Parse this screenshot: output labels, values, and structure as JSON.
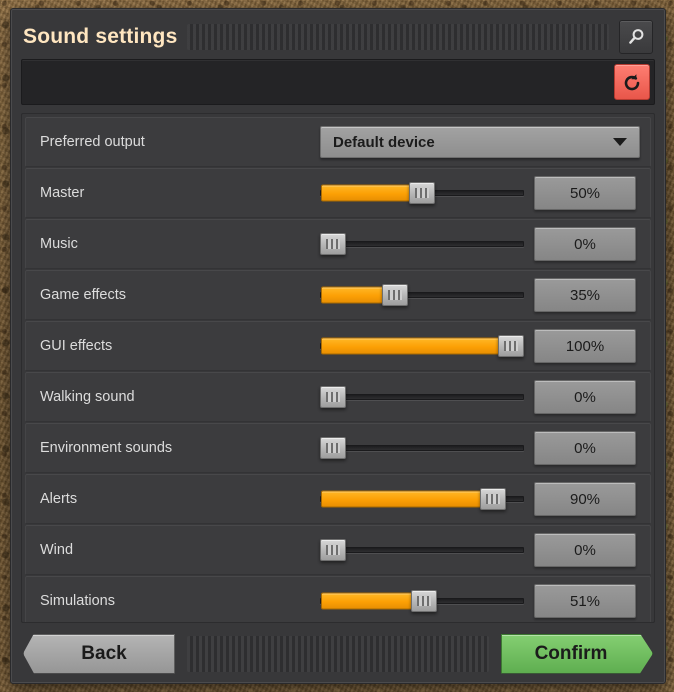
{
  "window": {
    "title": "Sound settings",
    "search_icon": "search-icon",
    "reset_icon": "reset-counterclockwise-arrow-icon"
  },
  "colors": {
    "accent_orange": "#fca005",
    "reset_red": "#e8564a",
    "confirm_green": "#5fae50",
    "panel_bg": "#38383a",
    "row_bg": "#3c3c3e",
    "label_text": "#dcdcdc",
    "title_text": "#ffe6c0"
  },
  "settings": {
    "output": {
      "label": "Preferred output",
      "value": "Default device",
      "type": "dropdown"
    },
    "sliders": [
      {
        "label": "Master",
        "value": 50,
        "display": "50%"
      },
      {
        "label": "Music",
        "value": 0,
        "display": "0%"
      },
      {
        "label": "Game effects",
        "value": 35,
        "display": "35%"
      },
      {
        "label": "GUI effects",
        "value": 100,
        "display": "100%"
      },
      {
        "label": "Walking sound",
        "value": 0,
        "display": "0%"
      },
      {
        "label": "Environment sounds",
        "value": 0,
        "display": "0%"
      },
      {
        "label": "Alerts",
        "value": 90,
        "display": "90%"
      },
      {
        "label": "Wind",
        "value": 0,
        "display": "0%"
      },
      {
        "label": "Simulations",
        "value": 51,
        "display": "51%"
      }
    ]
  },
  "footer": {
    "back_label": "Back",
    "confirm_label": "Confirm"
  }
}
